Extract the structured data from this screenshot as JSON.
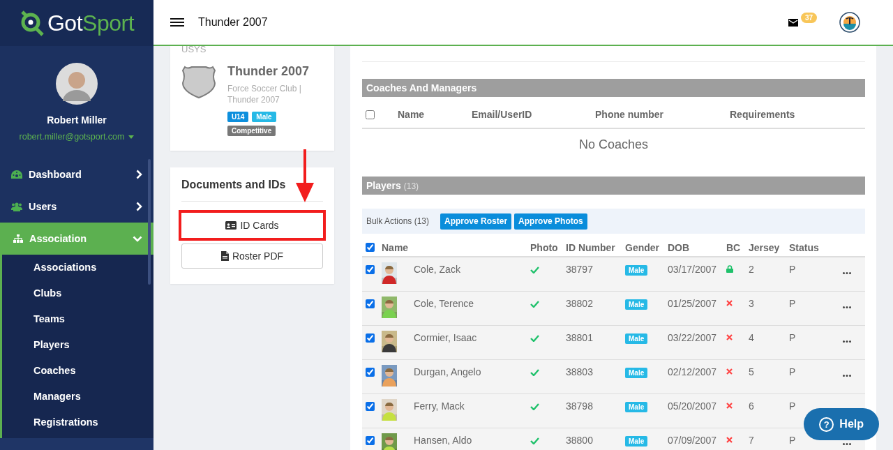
{
  "sidebar": {
    "logo": {
      "part_1": "Got",
      "part_2": "Sport"
    },
    "user": {
      "name": "Robert Miller",
      "email": "robert.miller@gotsport.com"
    },
    "nav": [
      {
        "label": "Dashboard",
        "selected": false,
        "expanded": false
      },
      {
        "label": "Users",
        "selected": false,
        "expanded": false
      },
      {
        "label": "Association",
        "selected": true,
        "expanded": true
      }
    ],
    "subnav": [
      {
        "label": "Associations"
      },
      {
        "label": "Clubs"
      },
      {
        "label": "Teams"
      },
      {
        "label": "Players"
      },
      {
        "label": "Coaches"
      },
      {
        "label": "Managers"
      },
      {
        "label": "Registrations"
      }
    ]
  },
  "header": {
    "title": "Thunder 2007",
    "mail_count": "37"
  },
  "team_card": {
    "org": "USYS",
    "name": "Thunder 2007",
    "subtitle": "Force Soccer Club | Thunder 2007",
    "tags": [
      {
        "label": "U14",
        "color": "#0d8fdd"
      },
      {
        "label": "Male",
        "color": "#26b9e6"
      },
      {
        "label": "Competitive",
        "color": "#777777"
      }
    ]
  },
  "documents": {
    "title": "Documents and IDs",
    "buttons": [
      {
        "label": "ID Cards",
        "highlighted": true
      },
      {
        "label": "Roster PDF",
        "highlighted": false
      }
    ]
  },
  "coaches": {
    "title": "Coaches And Managers",
    "select_all_checked": false,
    "columns": [
      "Name",
      "Email/UserID",
      "Phone number",
      "Requirements"
    ],
    "empty": "No Coaches"
  },
  "players": {
    "title": "Players",
    "count": "(13)",
    "bulk_label": "Bulk Actions (13)",
    "bulk_buttons": [
      "Approve Roster",
      "Approve Photos"
    ],
    "select_all_checked": true,
    "columns": [
      "Name",
      "Photo",
      "ID Number",
      "Gender",
      "DOB",
      "BC",
      "Jersey",
      "Status"
    ],
    "rows": [
      {
        "checked": true,
        "name": "Cole, Zack",
        "photo_approved": true,
        "id": "38797",
        "gender": "Male",
        "dob": "03/17/2007",
        "bc_verified": true,
        "jersey": "2",
        "status": "P"
      },
      {
        "checked": true,
        "name": "Cole, Terence",
        "photo_approved": true,
        "id": "38802",
        "gender": "Male",
        "dob": "01/25/2007",
        "bc_verified": false,
        "jersey": "3",
        "status": "P"
      },
      {
        "checked": true,
        "name": "Cormier, Isaac",
        "photo_approved": true,
        "id": "38801",
        "gender": "Male",
        "dob": "03/22/2007",
        "bc_verified": false,
        "jersey": "4",
        "status": "P"
      },
      {
        "checked": true,
        "name": "Durgan, Angelo",
        "photo_approved": true,
        "id": "38803",
        "gender": "Male",
        "dob": "02/12/2007",
        "bc_verified": false,
        "jersey": "5",
        "status": "P"
      },
      {
        "checked": true,
        "name": "Ferry, Mack",
        "photo_approved": true,
        "id": "38798",
        "gender": "Male",
        "dob": "05/20/2007",
        "bc_verified": false,
        "jersey": "6",
        "status": "P"
      },
      {
        "checked": true,
        "name": "Hansen, Aldo",
        "photo_approved": true,
        "id": "38800",
        "gender": "Male",
        "dob": "07/09/2007",
        "bc_verified": false,
        "jersey": "7",
        "status": "P"
      }
    ]
  },
  "help": {
    "icon": "?",
    "label": "Help"
  }
}
